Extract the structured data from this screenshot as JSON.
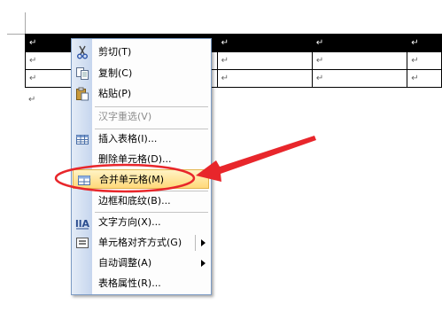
{
  "table": {
    "rows": [
      [
        "↵",
        "",
        "↵",
        "↵",
        "↵"
      ],
      [
        "↵",
        "↵",
        "↵",
        "↵",
        "↵"
      ],
      [
        "↵",
        "↵",
        "↵",
        "↵",
        "↵"
      ]
    ]
  },
  "after_table_mark": "↵",
  "context_menu": {
    "items": [
      {
        "label": "剪切(T)",
        "icon": "scissors-icon"
      },
      {
        "label": "复制(C)",
        "icon": "copy-icon"
      },
      {
        "label": "粘贴(P)",
        "icon": "paste-icon"
      },
      {
        "label": "汉字重选(V)",
        "state": "disabled"
      },
      {
        "label": "插入表格(I)...",
        "icon": "insert-table-icon"
      },
      {
        "label": "删除单元格(D)..."
      },
      {
        "label": "合并单元格(M)",
        "icon": "merge-cells-icon",
        "state": "highlighted"
      },
      {
        "label": "边框和底纹(B)..."
      },
      {
        "label": "文字方向(X)...",
        "icon": "text-direction-icon"
      },
      {
        "label": "单元格对齐方式(G)",
        "icon": "cell-align-icon",
        "submenu": true
      },
      {
        "label": "自动调整(A)",
        "submenu": true
      },
      {
        "label": "表格属性(R)..."
      }
    ]
  },
  "annotation": {
    "color": "#e8262b"
  }
}
